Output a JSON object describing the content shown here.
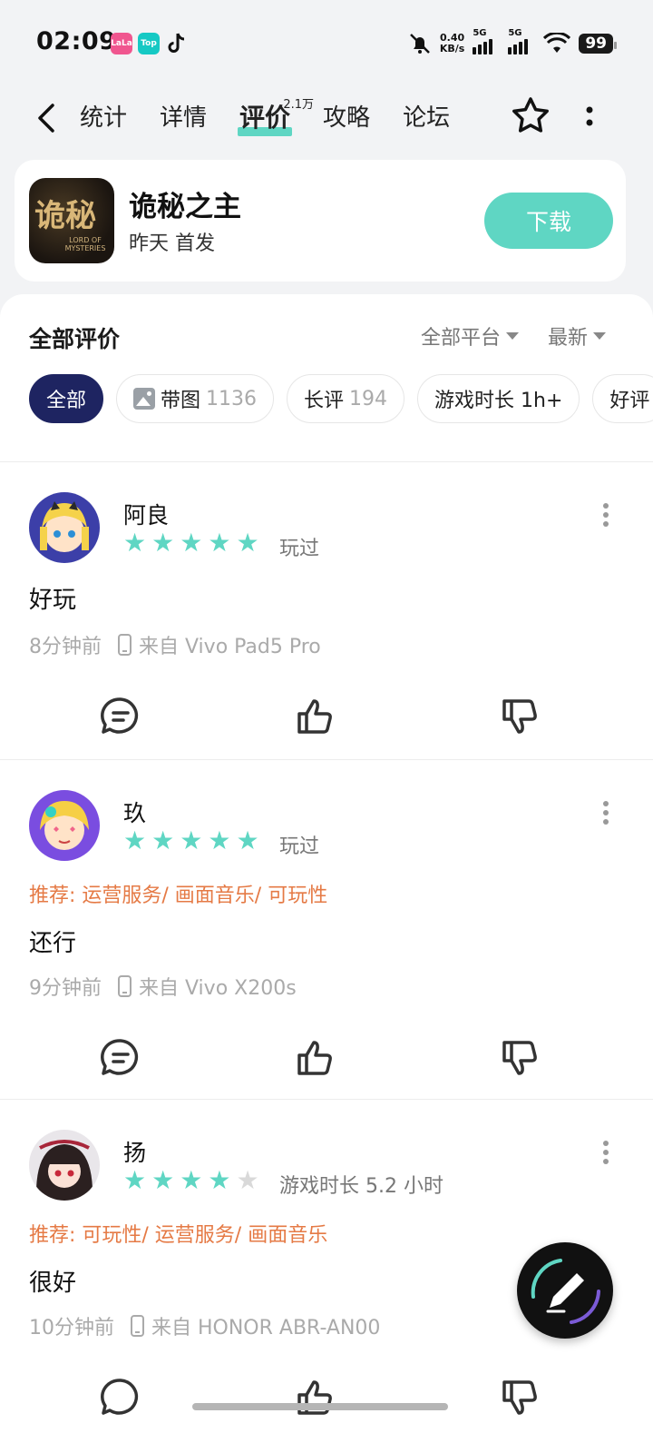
{
  "status": {
    "time": "02:09",
    "apps": [
      "LaLa",
      "Top"
    ],
    "speed_value": "0.40",
    "speed_unit": "KB/s",
    "sim1": "5G",
    "sim2": "5G",
    "battery": "99"
  },
  "nav": {
    "tabs": [
      {
        "label": "统计"
      },
      {
        "label": "详情"
      },
      {
        "label": "评价",
        "badge": "2.1万"
      },
      {
        "label": "攻略"
      },
      {
        "label": "论坛"
      }
    ]
  },
  "game": {
    "name": "诡秘之主",
    "subtitle": "昨天 首发",
    "icon_text": "诡秘",
    "icon_subtext": "LORD OF MYSTERIES",
    "download_label": "下载"
  },
  "reviews_section": {
    "title": "全部评价",
    "platform_filter": "全部平台",
    "sort_filter": "最新",
    "chips": [
      {
        "label": "全部",
        "count": ""
      },
      {
        "label": "带图",
        "count": "1136"
      },
      {
        "label": "长评",
        "count": "194"
      },
      {
        "label": "游戏时长 1h+",
        "count": ""
      },
      {
        "label": "好评",
        "count": ""
      }
    ]
  },
  "reviews": [
    {
      "user": "阿良",
      "rating": 5,
      "tag": "玩过",
      "recommend": "",
      "content": "好玩",
      "time": "8分钟前",
      "device": "来自 Vivo Pad5 Pro"
    },
    {
      "user": "玖",
      "rating": 5,
      "tag": "玩过",
      "recommend": "推荐: 运营服务/ 画面音乐/ 可玩性",
      "content": "还行",
      "time": "9分钟前",
      "device": "来自 Vivo X200s"
    },
    {
      "user": "扬",
      "rating": 4,
      "tag": "游戏时长 5.2 小时",
      "recommend": "推荐: 可玩性/ 运营服务/ 画面音乐",
      "content": "很好",
      "time": "10分钟前",
      "device": "来自 HONOR ABR-AN00"
    }
  ],
  "colors": {
    "accent": "#5fd6c3",
    "chip_active": "#1e2461",
    "recommend": "#e57a45"
  }
}
